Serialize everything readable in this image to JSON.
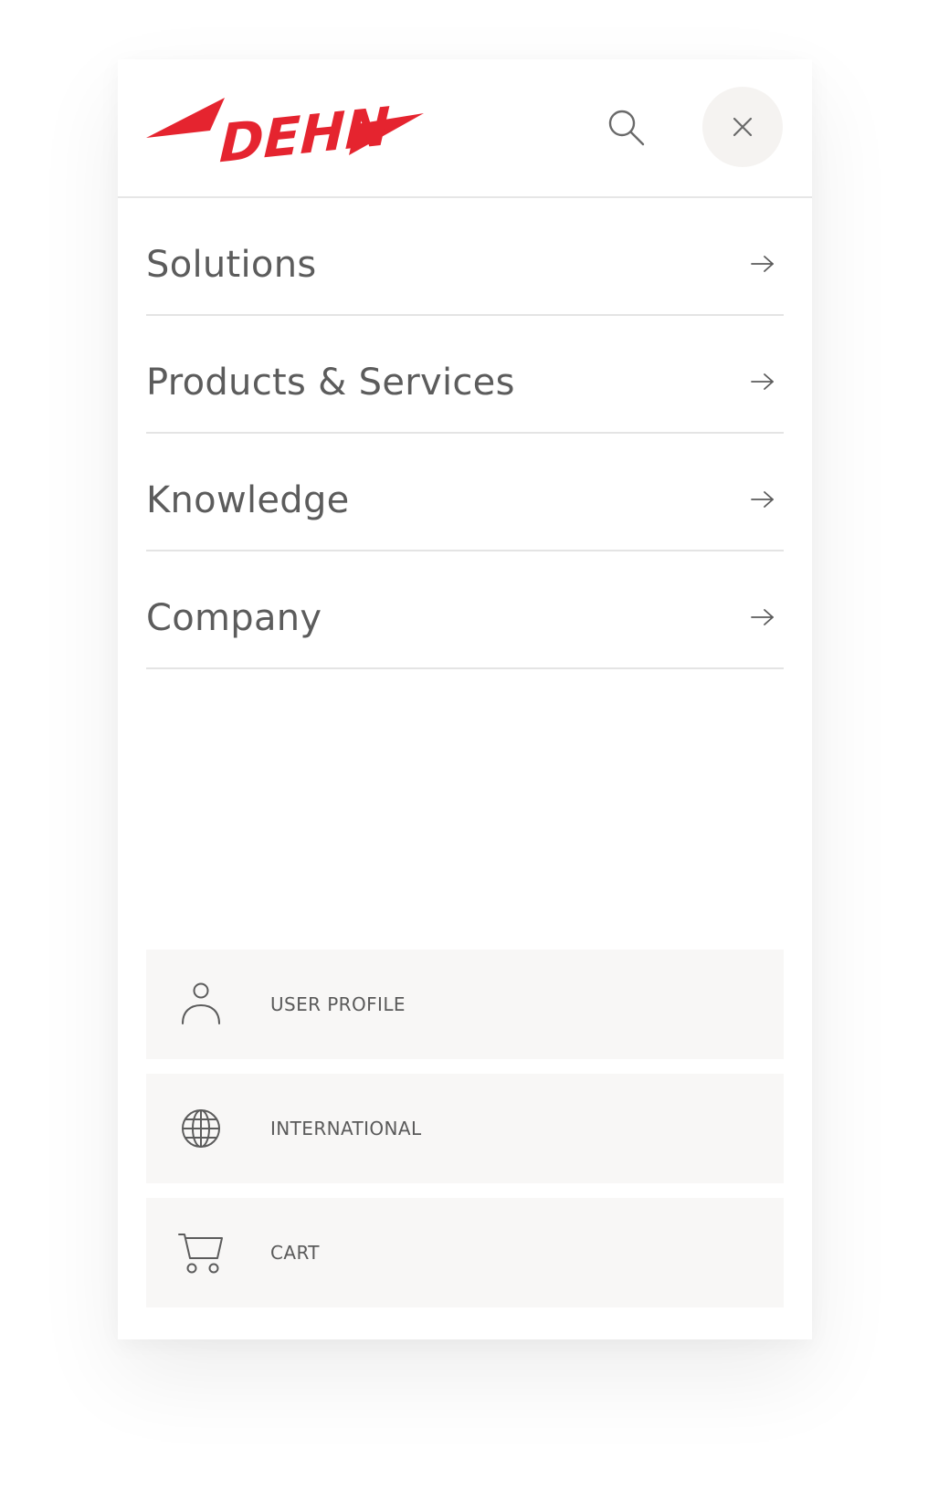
{
  "brand": {
    "name": "DEHN",
    "color": "#e5242f"
  },
  "header": {
    "search_icon": "search-icon",
    "close_icon": "close-icon"
  },
  "nav": {
    "items": [
      {
        "label": "Solutions",
        "icon": "arrow-right-icon"
      },
      {
        "label": "Products & Services",
        "icon": "arrow-right-icon"
      },
      {
        "label": "Knowledge",
        "icon": "arrow-right-icon"
      },
      {
        "label": "Company",
        "icon": "arrow-right-icon"
      }
    ]
  },
  "utility": {
    "items": [
      {
        "label": "USER PROFILE",
        "icon": "user-icon"
      },
      {
        "label": "INTERNATIONAL",
        "icon": "globe-icon"
      },
      {
        "label": "CART",
        "icon": "cart-icon"
      }
    ]
  }
}
